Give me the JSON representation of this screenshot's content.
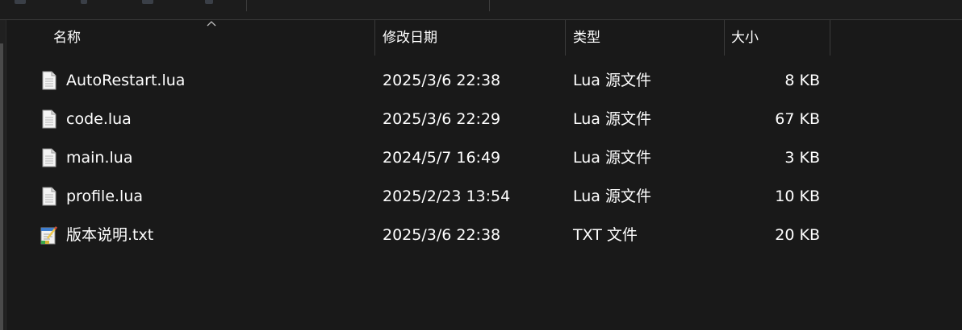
{
  "columns": {
    "name": "名称",
    "date": "修改日期",
    "type": "类型",
    "size": "大小"
  },
  "files": [
    {
      "name": "AutoRestart.lua",
      "date": "2025/3/6 22:38",
      "type": "Lua 源文件",
      "size": "8 KB",
      "icon": "lua-file-icon"
    },
    {
      "name": "code.lua",
      "date": "2025/3/6 22:29",
      "type": "Lua 源文件",
      "size": "67 KB",
      "icon": "lua-file-icon"
    },
    {
      "name": "main.lua",
      "date": "2024/5/7 16:49",
      "type": "Lua 源文件",
      "size": "3 KB",
      "icon": "lua-file-icon"
    },
    {
      "name": "profile.lua",
      "date": "2025/2/23 13:54",
      "type": "Lua 源文件",
      "size": "10 KB",
      "icon": "lua-file-icon"
    },
    {
      "name": "版本说明.txt",
      "date": "2025/3/6 22:38",
      "type": "TXT 文件",
      "size": "20 KB",
      "icon": "notepad-file-icon"
    }
  ],
  "colors": {
    "background": "#191919",
    "text": "#ffffff",
    "divider": "#3a3a3a"
  }
}
